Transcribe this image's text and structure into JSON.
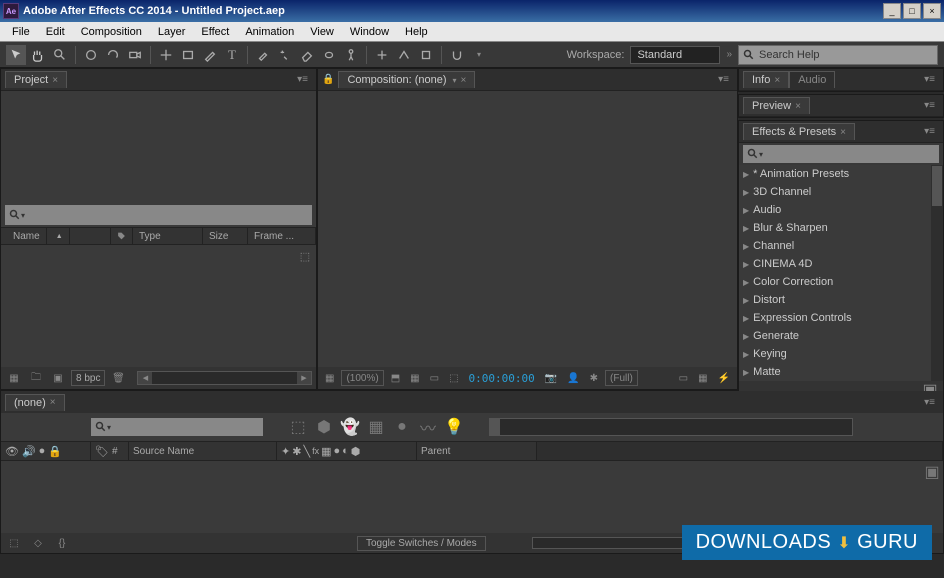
{
  "titlebar": {
    "app_icon": "Ae",
    "title": "Adobe After Effects CC 2014 - Untitled Project.aep"
  },
  "menubar": [
    "File",
    "Edit",
    "Composition",
    "Layer",
    "Effect",
    "Animation",
    "View",
    "Window",
    "Help"
  ],
  "toolbar": {
    "workspace_label": "Workspace:",
    "workspace_value": "Standard",
    "search_placeholder": "Search Help"
  },
  "project_panel": {
    "tab": "Project",
    "columns": {
      "name": "Name",
      "type": "Type",
      "size": "Size",
      "frame": "Frame ..."
    },
    "footer_bpc": "8 bpc"
  },
  "comp_panel": {
    "tab": "Composition: (none)",
    "footer": {
      "zoom": "(100%)",
      "time": "0:00:00:00",
      "res": "(Full)"
    }
  },
  "right": {
    "info_tab": "Info",
    "audio_tab": "Audio",
    "preview_tab": "Preview",
    "effects_tab": "Effects & Presets",
    "categories": [
      "* Animation Presets",
      "3D Channel",
      "Audio",
      "Blur & Sharpen",
      "Channel",
      "CINEMA 4D",
      "Color Correction",
      "Distort",
      "Expression Controls",
      "Generate",
      "Keying",
      "Matte"
    ]
  },
  "timeline": {
    "tab": "(none)",
    "col_idx": "#",
    "col_source": "Source Name",
    "col_parent": "Parent",
    "toggle_label": "Toggle Switches / Modes"
  },
  "watermark": {
    "main": "DOWNLOADS",
    "suffix": "GURU"
  }
}
